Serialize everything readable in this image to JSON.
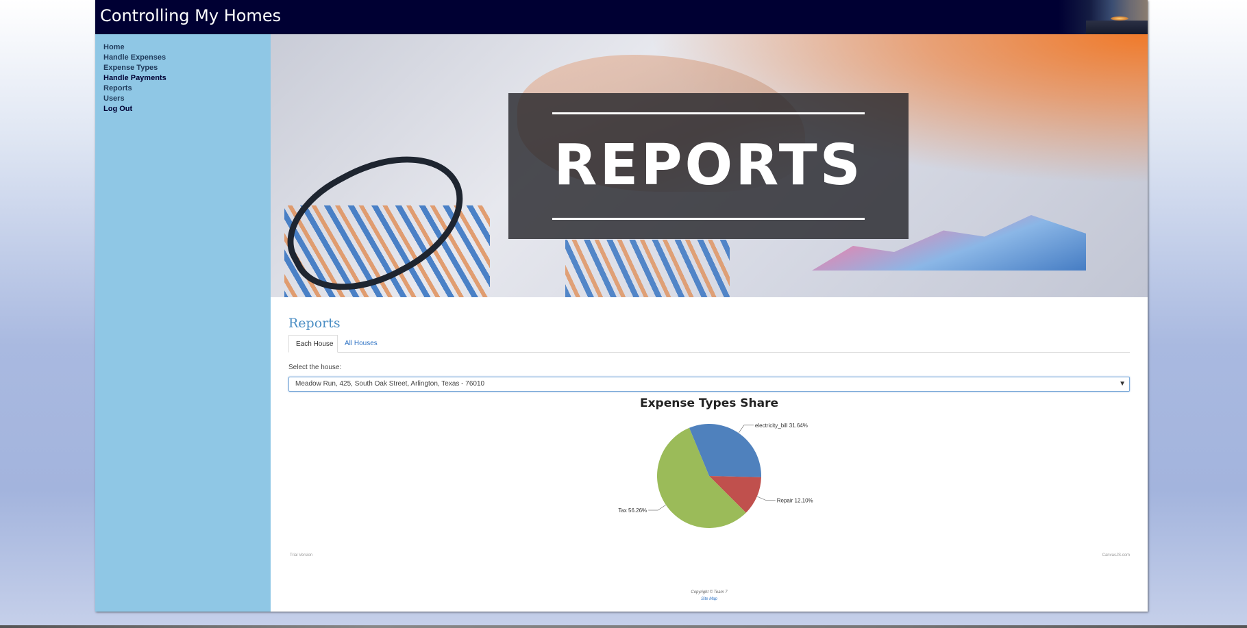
{
  "header": {
    "title": "Controlling My Homes"
  },
  "sidebar": {
    "items": [
      {
        "label": "Home"
      },
      {
        "label": "Handle Expenses"
      },
      {
        "label": "Expense Types"
      },
      {
        "label": "Handle Payments"
      },
      {
        "label": "Reports"
      },
      {
        "label": "Users"
      },
      {
        "label": "Log Out"
      }
    ]
  },
  "banner": {
    "title": "REPORTS"
  },
  "main": {
    "heading": "Reports",
    "tabs": [
      {
        "label": "Each House",
        "active": true
      },
      {
        "label": "All Houses",
        "active": false
      }
    ],
    "select_label": "Select the house:",
    "selected_house": "Meadow Run, 425, South Oak Street, Arlington, Texas - 76010"
  },
  "chart_data": {
    "type": "pie",
    "title": "Expense Types Share",
    "slices": [
      {
        "label": "electricity_bill 31.64%",
        "value": 31.64,
        "color": "#4f81bd"
      },
      {
        "label": "Repair 12.10%",
        "value": 12.1,
        "color": "#c0504d"
      },
      {
        "label": "Tax 56.26%",
        "value": 56.26,
        "color": "#9bbb59"
      }
    ]
  },
  "watermarks": {
    "left": "Trial Version",
    "right": "CanvasJS.com"
  },
  "footer": {
    "copyright": "Copyright © Team 7",
    "sitemap": "Site Map"
  },
  "colors": {
    "header": "#000033",
    "sidebar": "#8fc7e5",
    "accent": "#4b8ec4"
  }
}
